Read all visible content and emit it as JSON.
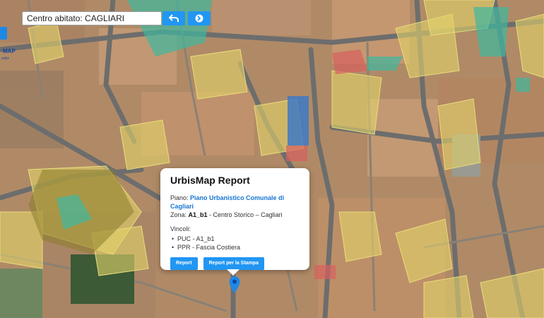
{
  "app": {
    "logo_text": "MAP",
    "logo_sub": "urbis"
  },
  "search": {
    "value": "Centro abitato: CAGLIARI"
  },
  "toolbar": {
    "back_icon": "undo-arrow-icon",
    "go_icon": "arrow-right-circle-icon"
  },
  "popup": {
    "title": "UrbisMap Report",
    "piano_label": "Piano:",
    "piano_value": "Piano Urbanistico Comunale di Cagliari",
    "zona_label": "Zona:",
    "zona_code": "A1_b1",
    "zona_desc": " - Centro Storico – Cagliari",
    "vincoli_label": "Vincoli:",
    "vincoli": [
      "PUC - A1_b1",
      "PPR - Fascia Costiera"
    ],
    "report_button": "Report",
    "print_button": "Report per la Stampa"
  },
  "map": {
    "marker_icon": "map-pin-icon",
    "colors": {
      "roof": "#b5906e",
      "zone_yellow": "#e3d36a",
      "zone_teal": "#3fb8a0",
      "zone_blue": "#3d79c6",
      "zone_red": "#d9605f",
      "road": "#6d6d6d",
      "accent": "#2196f3"
    }
  }
}
